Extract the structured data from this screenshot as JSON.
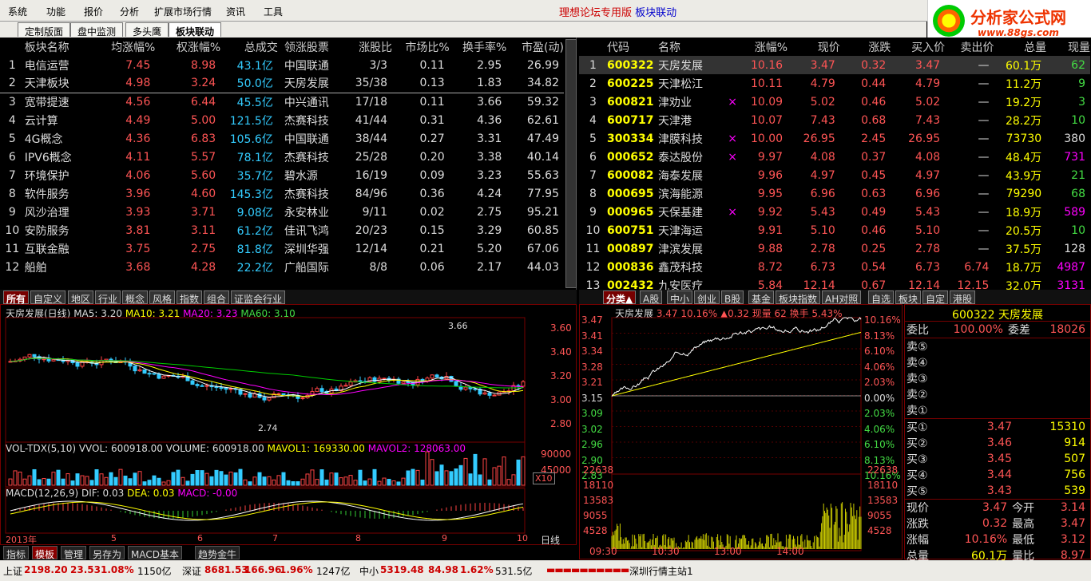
{
  "menu": [
    "系统",
    "功能",
    "报价",
    "分析",
    "扩展市场行情",
    "资讯",
    "工具"
  ],
  "window_title": "理想论坛专用版",
  "window_title_b": "板块联动",
  "logo": {
    "t1": "分析家公式网",
    "t2": "www.88gs.com"
  },
  "tabs": [
    "定制版面",
    "盘中监测",
    "多头鹰",
    "板块联动"
  ],
  "sector_table": {
    "headers": [
      "板块名称",
      "均涨幅%",
      "权涨幅%",
      "总成交",
      "领涨股票",
      "涨股比",
      "市场比%",
      "换手率%",
      "市盈(动)"
    ],
    "rows": [
      [
        "1",
        "电信运营",
        "7.45",
        "8.98",
        "43.1亿",
        "中国联通",
        "3/3",
        "0.11",
        "2.95",
        "26.99"
      ],
      [
        "2",
        "天津板块",
        "4.98",
        "3.24",
        "50.0亿",
        "天房发展",
        "35/38",
        "0.13",
        "1.83",
        "34.82"
      ],
      [
        "3",
        "宽带提速",
        "4.56",
        "6.44",
        "45.5亿",
        "中兴通讯",
        "17/18",
        "0.11",
        "3.66",
        "59.32"
      ],
      [
        "4",
        "云计算",
        "4.49",
        "5.00",
        "121.5亿",
        "杰赛科技",
        "41/44",
        "0.31",
        "4.36",
        "62.61"
      ],
      [
        "5",
        "4G概念",
        "4.36",
        "6.83",
        "105.6亿",
        "中国联通",
        "38/44",
        "0.27",
        "3.31",
        "47.49"
      ],
      [
        "6",
        "IPV6概念",
        "4.11",
        "5.57",
        "78.1亿",
        "杰赛科技",
        "25/28",
        "0.20",
        "3.38",
        "40.14"
      ],
      [
        "7",
        "环境保护",
        "4.06",
        "5.60",
        "35.7亿",
        "碧水源",
        "16/19",
        "0.09",
        "3.23",
        "55.63"
      ],
      [
        "8",
        "软件服务",
        "3.96",
        "4.60",
        "145.3亿",
        "杰赛科技",
        "84/96",
        "0.36",
        "4.24",
        "77.95"
      ],
      [
        "9",
        "风沙治理",
        "3.93",
        "3.71",
        "9.08亿",
        "永安林业",
        "9/11",
        "0.02",
        "2.75",
        "95.21"
      ],
      [
        "10",
        "安防服务",
        "3.81",
        "3.11",
        "61.2亿",
        "佳讯飞鸿",
        "20/23",
        "0.15",
        "3.29",
        "60.85"
      ],
      [
        "11",
        "互联金融",
        "3.75",
        "2.75",
        "81.8亿",
        "深圳华强",
        "12/14",
        "0.21",
        "5.20",
        "67.06"
      ],
      [
        "12",
        "船舶",
        "3.68",
        "4.28",
        "22.2亿",
        "广船国际",
        "8/8",
        "0.06",
        "2.17",
        "44.03"
      ]
    ]
  },
  "stock_table": {
    "headers": [
      "代码",
      "名称",
      "涨幅%",
      "现价",
      "涨跌",
      "买入价",
      "卖出价",
      "总量",
      "现量"
    ],
    "rows": [
      [
        "1",
        "600322",
        "天房发展",
        "",
        "10.16",
        "3.47",
        "0.32",
        "3.47",
        "—",
        "60.1万",
        "62"
      ],
      [
        "2",
        "600225",
        "天津松江",
        "",
        "10.11",
        "4.79",
        "0.44",
        "4.79",
        "—",
        "11.2万",
        "9"
      ],
      [
        "3",
        "600821",
        "津劝业",
        "×",
        "10.09",
        "5.02",
        "0.46",
        "5.02",
        "—",
        "19.2万",
        "3"
      ],
      [
        "4",
        "600717",
        "天津港",
        "",
        "10.07",
        "7.43",
        "0.68",
        "7.43",
        "—",
        "28.2万",
        "10"
      ],
      [
        "5",
        "300334",
        "津膜科技",
        "×",
        "10.00",
        "26.95",
        "2.45",
        "26.95",
        "—",
        "73730",
        "380"
      ],
      [
        "6",
        "000652",
        "泰达股份",
        "×",
        "9.97",
        "4.08",
        "0.37",
        "4.08",
        "—",
        "48.4万",
        "731"
      ],
      [
        "7",
        "600082",
        "海泰发展",
        "",
        "9.96",
        "4.97",
        "0.45",
        "4.97",
        "—",
        "43.9万",
        "21"
      ],
      [
        "8",
        "000695",
        "滨海能源",
        "",
        "9.95",
        "6.96",
        "0.63",
        "6.96",
        "—",
        "79290",
        "68"
      ],
      [
        "9",
        "000965",
        "天保基建",
        "×",
        "9.92",
        "5.43",
        "0.49",
        "5.43",
        "—",
        "18.9万",
        "589"
      ],
      [
        "10",
        "600751",
        "天津海运",
        "",
        "9.91",
        "5.10",
        "0.46",
        "5.10",
        "—",
        "20.5万",
        "10"
      ],
      [
        "11",
        "000897",
        "津滨发展",
        "",
        "9.88",
        "2.78",
        "0.25",
        "2.78",
        "—",
        "37.5万",
        "128"
      ],
      [
        "12",
        "000836",
        "鑫茂科技",
        "",
        "8.72",
        "6.73",
        "0.54",
        "6.73",
        "6.74",
        "18.7万",
        "4987"
      ],
      [
        "13",
        "002432",
        "九安医疗",
        "",
        "5.84",
        "12.14",
        "0.67",
        "12.14",
        "12.15",
        "32.0万",
        "3131"
      ]
    ]
  },
  "left_cats": [
    "所有",
    "自定义",
    "地区",
    "行业",
    "概念",
    "风格",
    "指数",
    "组合",
    "证监会行业"
  ],
  "right_cats": [
    "分类▲",
    "A股",
    "中小",
    "创业",
    "B股",
    "基金",
    "板块指数",
    "AH对照",
    "自选",
    "板块",
    "自定",
    "港股"
  ],
  "kline": {
    "title": "天房发展(日线)",
    "ma5": "MA5: 3.20",
    "ma10": "MA10: 3.21",
    "ma20": "MA20: 3.23",
    "ma60": "MA60: 3.10",
    "yticks": [
      "3.60",
      "3.40",
      "3.20",
      "3.00",
      "2.80"
    ],
    "high": "3.66",
    "low": "2.74",
    "year": "2013年",
    "months": [
      "5",
      "6",
      "7",
      "8",
      "9",
      "10"
    ],
    "vol_title": "VOL-TDX(5,10) VVOL: 600918.00",
    "vol_b": "VOLUME: 600918.00",
    "vol_c": "MAVOL1: 169330.00",
    "vol_d": "MAVOL2: 128063.00",
    "vol_ticks": [
      "90000",
      "45000",
      "X10"
    ],
    "macd_title": "MACD(12,26,9) DIF: 0.03",
    "macd_b": "DEA: 0.03",
    "macd_c": "MACD: -0.00",
    "period": "日线"
  },
  "bottom_tabs": [
    "指标",
    "模板",
    "管理",
    "另存为",
    "MACD基本",
    "趋势金牛"
  ],
  "intraday": {
    "title": "天房发展",
    "info": "3.47 10.16% ▲0.32 现量 62 换手 5.43%",
    "left_ticks": [
      "3.47",
      "3.41",
      "3.34",
      "3.28",
      "3.21",
      "3.15",
      "3.09",
      "3.02",
      "2.96",
      "2.90",
      "2.83"
    ],
    "right_ticks": [
      "10.16%",
      "8.13%",
      "6.10%",
      "4.06%",
      "2.03%",
      "0.00%",
      "2.03%",
      "4.06%",
      "6.10%",
      "8.13%",
      "10.16%"
    ],
    "vol_ticks": [
      "22638",
      "18110",
      "13583",
      "9055",
      "4528"
    ],
    "times": [
      "09:30",
      "10:30",
      "13:00",
      "14:00"
    ]
  },
  "orderbook": {
    "code_name": "600322 天房发展",
    "wb_label": "委比",
    "wb": "100.00%",
    "wc_label": "委差",
    "wc": "18026",
    "sell": [
      [
        "卖⑤",
        ""
      ],
      [
        "卖④",
        ""
      ],
      [
        "卖③",
        ""
      ],
      [
        "卖②",
        ""
      ],
      [
        "卖①",
        ""
      ]
    ],
    "buy": [
      [
        "买①",
        "3.47",
        "15310"
      ],
      [
        "买②",
        "3.46",
        "914"
      ],
      [
        "买③",
        "3.45",
        "507"
      ],
      [
        "买④",
        "3.44",
        "756"
      ],
      [
        "买⑤",
        "3.43",
        "539"
      ]
    ],
    "stats": [
      [
        "现价",
        "3.47",
        "今开",
        "3.14"
      ],
      [
        "涨跌",
        "0.32",
        "最高",
        "3.47"
      ],
      [
        "涨幅",
        "10.16%",
        "最低",
        "3.12"
      ],
      [
        "总量",
        "60.1万",
        "量比",
        "8.97"
      ]
    ]
  },
  "status": {
    "sh": "上证",
    "sh_v": "2198.20",
    "sh_c": "23.53",
    "sh_p": "1.08%",
    "sh_a": "1150亿",
    "sz": "深证",
    "sz_v": "8681.53",
    "sz_c": "166.96",
    "sz_p": "1.96%",
    "sz_a": "1247亿",
    "zx": "中小",
    "zx_v": "5319.48",
    "zx_c": "84.98",
    "zx_p": "1.62%",
    "zx_a": "531.5亿",
    "server": "深圳行情主站1"
  },
  "colors": {
    "up": "#ff5555",
    "down": "#44dd44",
    "amount": "#33ccff",
    "bg": "#000000"
  }
}
